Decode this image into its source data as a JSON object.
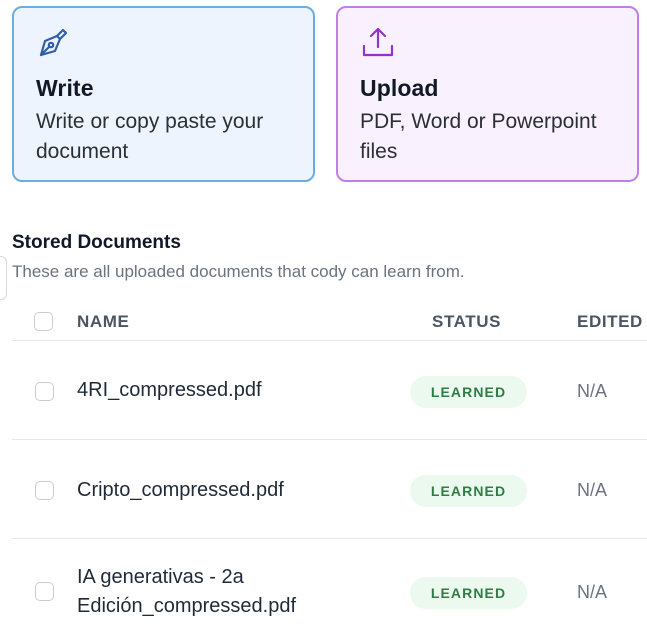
{
  "cards": {
    "write": {
      "title": "Write",
      "description": "Write or copy paste your document",
      "icon": "pen-nib-icon",
      "accent": "#2f5fa8"
    },
    "upload": {
      "title": "Upload",
      "description": "PDF, Word or Powerpoint files",
      "icon": "upload-tray-icon",
      "accent": "#9333c9"
    }
  },
  "stored": {
    "title": "Stored Documents",
    "subtitle": "These are all uploaded documents that cody can learn from."
  },
  "table": {
    "headers": {
      "name": "NAME",
      "status": "STATUS",
      "edited": "EDITED O"
    },
    "rows": [
      {
        "name": "4RI_compressed.pdf",
        "status": "LEARNED",
        "edited": "N/A"
      },
      {
        "name": "Cripto_compressed.pdf",
        "status": "LEARNED",
        "edited": "N/A"
      },
      {
        "name": "IA generativas - 2a Edición_compressed.pdf",
        "status": "LEARNED",
        "edited": "N/A"
      }
    ]
  },
  "colors": {
    "write_bg": "#eef4fe",
    "write_border": "#6aaee0",
    "upload_bg": "#f9f1fe",
    "upload_border": "#c07ee6",
    "learned_bg": "#ecf9ef",
    "learned_text": "#2f7d45"
  }
}
